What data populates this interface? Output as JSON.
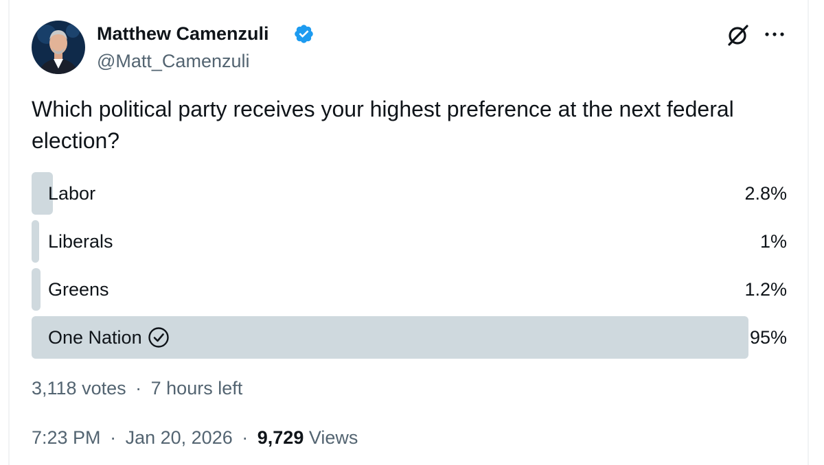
{
  "author": {
    "display_name": "Matthew Camenzuli",
    "handle": "@Matt_Camenzuli",
    "verified_icon": "verified-badge-icon",
    "avatar_icon": "profile-photo"
  },
  "actions": {
    "grok_icon": "grok-icon",
    "more_icon": "more-options-icon"
  },
  "tweet": {
    "question": "Which political party receives your highest preference at the next federal election?"
  },
  "poll": {
    "options": [
      {
        "label": "Labor",
        "percent_text": "2.8%",
        "percent": 2.8,
        "selected": false
      },
      {
        "label": "Liberals",
        "percent_text": "1%",
        "percent": 1,
        "selected": false
      },
      {
        "label": "Greens",
        "percent_text": "1.2%",
        "percent": 1.2,
        "selected": false
      },
      {
        "label": "One Nation",
        "percent_text": "95%",
        "percent": 95,
        "selected": true
      }
    ],
    "votes": "3,118 votes",
    "dot": "·",
    "time_left": "7 hours left"
  },
  "meta": {
    "time": "7:23 PM",
    "dot1": "·",
    "date": "Jan 20, 2026",
    "dot2": "·",
    "views_count": "9,729",
    "views_label": "Views"
  },
  "colors": {
    "bar_fill": "#cfd9de",
    "secondary_text": "#536471",
    "primary_text": "#0f1419",
    "verified_blue": "#1d9bf0"
  }
}
